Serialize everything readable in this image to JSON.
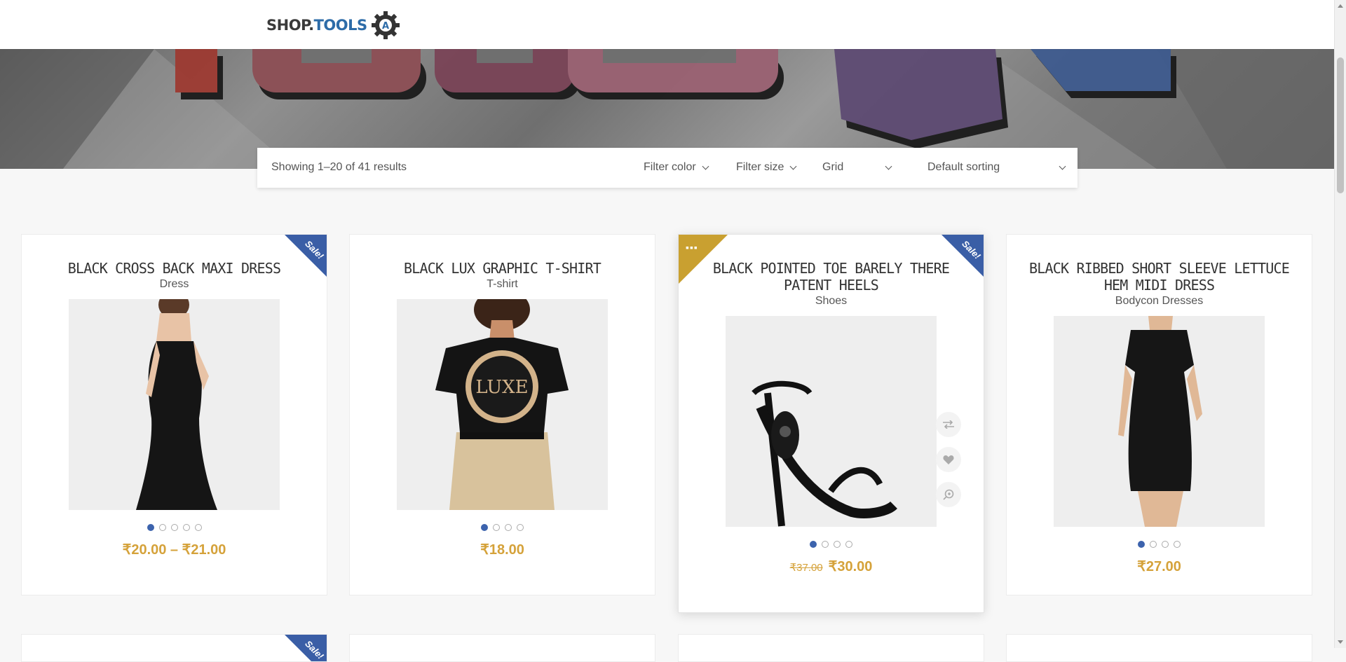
{
  "header": {
    "logo_part1": "SHOP.",
    "logo_part2": "TOOLS",
    "logo_gear_letter": "A"
  },
  "toolbar": {
    "result_count": "Showing 1–20 of 41 results",
    "filter_color": "Filter color",
    "filter_size": "Filter size",
    "view": "Grid",
    "sorting": "Default sorting"
  },
  "products": [
    {
      "title": "BLACK CROSS BACK MAXI DRESS",
      "category": "Dress",
      "price": "₹20.00 – ₹21.00",
      "sale_label": "Sale!",
      "dots": 5
    },
    {
      "title": "BLACK LUX GRAPHIC T-SHIRT",
      "category": "T-shirt",
      "price": "₹18.00",
      "dots": 4,
      "graphic_text": "LUXE"
    },
    {
      "title": "BLACK POINTED TOE BARELY THERE PATENT HEELS",
      "category": "Shoes",
      "old_price": "₹37.00",
      "price": "₹30.00",
      "sale_label": "Sale!",
      "featured_label": "▪▪▪",
      "dots": 4
    },
    {
      "title": "BLACK RIBBED SHORT SLEEVE LETTUCE HEM MIDI DRESS",
      "category": "Bodycon Dresses",
      "price": "₹27.00",
      "dots": 4
    }
  ],
  "row2": {
    "sale_label": "Sale!"
  },
  "icons": {
    "compare": "compare-icon",
    "wishlist": "heart-icon",
    "quickview": "zoom-icon"
  },
  "colors": {
    "accent_gold": "#d5a23a",
    "sale_blue": "#3a5ea6",
    "featured_gold": "#c9a030",
    "active_dot": "#3c63ad"
  }
}
